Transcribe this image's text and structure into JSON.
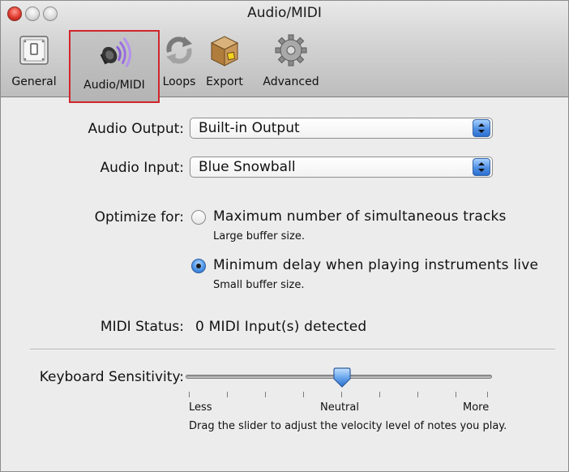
{
  "window": {
    "title": "Audio/MIDI"
  },
  "toolbar": {
    "items": [
      {
        "label": "General",
        "icon": "switch-icon",
        "selected": false
      },
      {
        "label": "Audio/MIDI",
        "icon": "speaker-icon",
        "selected": true
      },
      {
        "label": "Loops",
        "icon": "loop-arrows-icon",
        "selected": false
      },
      {
        "label": "Export",
        "icon": "box-icon",
        "selected": false
      },
      {
        "label": "Advanced",
        "icon": "gear-icon",
        "selected": false
      }
    ],
    "selected_highlight_color": "#d0262b"
  },
  "audio_output": {
    "label": "Audio Output:",
    "value": "Built-in Output"
  },
  "audio_input": {
    "label": "Audio Input:",
    "value": "Blue Snowball"
  },
  "optimize": {
    "label": "Optimize for:",
    "options": [
      {
        "title": "Maximum number of simultaneous tracks",
        "subtitle": "Large buffer size.",
        "selected": false
      },
      {
        "title": "Minimum delay when playing instruments live",
        "subtitle": "Small buffer size.",
        "selected": true
      }
    ]
  },
  "midi": {
    "label": "MIDI Status:",
    "value": "0 MIDI Input(s) detected"
  },
  "keyboard_sensitivity": {
    "label": "Keyboard Sensitivity:",
    "position_fraction": 0.5,
    "tick_labels": {
      "min": "Less",
      "mid": "Neutral",
      "max": "More"
    },
    "help": "Drag the slider to adjust the velocity level of notes you play."
  },
  "colors": {
    "accent_blue": "#4d94e8",
    "window_bg": "#ececec"
  }
}
